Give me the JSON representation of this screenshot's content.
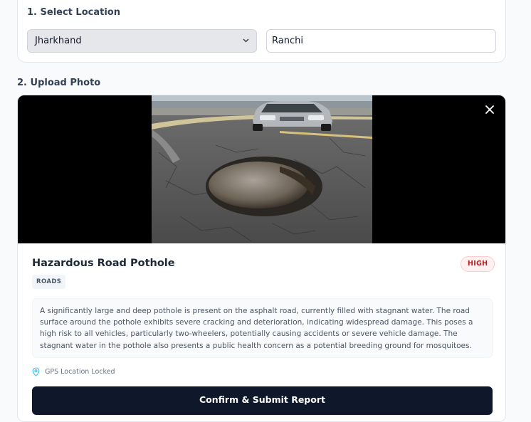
{
  "location": {
    "section_label": "1. Select Location",
    "state_value": "Jharkhand",
    "city_value": "Ranchi"
  },
  "upload": {
    "section_label": "2. Upload Photo",
    "close_icon": "✕"
  },
  "report": {
    "title": "Hazardous Road Pothole",
    "severity": "HIGH",
    "category": "ROADS",
    "description": "A significantly large and deep pothole is present on the asphalt road, currently filled with stagnant water. The road surface around the pothole exhibits severe cracking and deterioration, indicating widespread damage. This poses a high risk to all vehicles, particularly two-wheelers, potentially causing accidents or severe vehicle damage. The stagnant water in the pothole also presents a public health concern as a potential breeding ground for mosquitoes.",
    "gps_status": "GPS Location Locked",
    "submit_label": "Confirm & Submit Report"
  },
  "colors": {
    "severity_high": "#b91c1c",
    "primary_button": "#0f172a",
    "gps_icon": "#38bdf8"
  },
  "icons": {
    "close": "close-icon",
    "gps": "location-pin-icon",
    "dropdown": "chevron-down-icon"
  }
}
